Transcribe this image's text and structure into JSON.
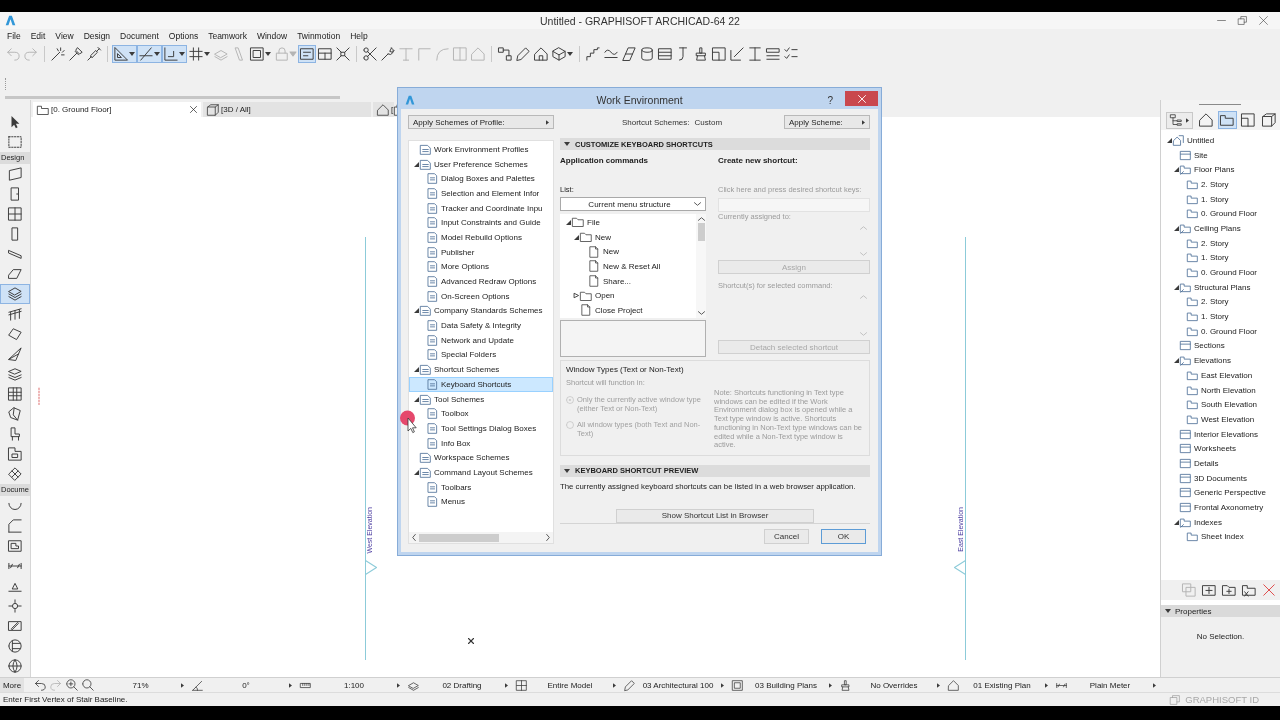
{
  "window": {
    "title": "Untitled - GRAPHISOFT ARCHICAD-64 22"
  },
  "menu_bar": [
    "File",
    "Edit",
    "View",
    "Design",
    "Document",
    "Options",
    "Teamwork",
    "Window",
    "Twinmotion",
    "Help"
  ],
  "toolbar": [
    [
      {
        "selected": false,
        "disabled": true
      },
      {
        "selected": false,
        "disabled": true
      }
    ],
    [
      {
        "selected": false,
        "disabled": false
      },
      {
        "selected": false,
        "disabled": false
      },
      {
        "selected": false,
        "disabled": false
      }
    ],
    [
      {
        "selected": true,
        "disabled": false,
        "dropdown": true
      },
      {
        "selected": true,
        "disabled": false,
        "dropdown": true
      },
      {
        "selected": true,
        "disabled": false,
        "dropdown": true
      },
      {
        "selected": false,
        "disabled": false,
        "dropdown": true
      },
      {
        "selected": false,
        "disabled": true
      },
      {
        "selected": false,
        "disabled": true
      },
      {
        "selected": false,
        "disabled": false,
        "dropdown": true
      },
      {
        "selected": false,
        "disabled": true,
        "dropdown": true
      },
      {
        "selected": true,
        "disabled": false
      },
      {
        "selected": false,
        "disabled": false
      },
      {
        "selected": false,
        "disabled": false
      }
    ],
    [
      {
        "selected": false,
        "disabled": false
      },
      {
        "selected": false,
        "disabled": false
      },
      {
        "selected": false,
        "disabled": true
      },
      {
        "selected": false,
        "disabled": true
      },
      {
        "selected": false,
        "disabled": true
      },
      {
        "selected": false,
        "disabled": true
      },
      {
        "selected": false,
        "disabled": true
      }
    ],
    [
      {
        "selected": false,
        "disabled": false
      },
      {
        "selected": false,
        "disabled": false
      },
      {
        "selected": false,
        "disabled": false
      },
      {
        "selected": false,
        "disabled": false,
        "dropdown": true
      }
    ],
    [
      {
        "selected": false,
        "disabled": false
      },
      {
        "selected": false,
        "disabled": false
      },
      {
        "selected": false,
        "disabled": false
      },
      {
        "selected": false,
        "disabled": false
      },
      {
        "selected": false,
        "disabled": false
      },
      {
        "selected": false,
        "disabled": false
      },
      {
        "selected": false,
        "disabled": false
      },
      {
        "selected": false,
        "disabled": false
      },
      {
        "selected": false,
        "disabled": false
      },
      {
        "selected": false,
        "disabled": false
      },
      {
        "selected": false,
        "disabled": false
      },
      {
        "selected": false,
        "disabled": false
      }
    ]
  ],
  "toolbox": {
    "pointer_tools": [
      {
        "selected": false
      },
      {
        "selected": false
      }
    ],
    "sections": [
      {
        "label": "Design",
        "tools": [
          {
            "selected": false
          },
          {
            "selected": false
          },
          {
            "selected": false
          },
          {
            "selected": false
          },
          {
            "selected": false
          },
          {
            "selected": false
          },
          {
            "selected": true
          },
          {
            "selected": false
          },
          {
            "selected": false
          },
          {
            "selected": false
          },
          {
            "selected": false
          },
          {
            "selected": false
          },
          {
            "selected": false
          },
          {
            "selected": false
          },
          {
            "selected": false
          },
          {
            "selected": false
          }
        ]
      },
      {
        "label": "Docume",
        "tools": [
          {
            "selected": false
          },
          {
            "selected": false
          },
          {
            "selected": false
          },
          {
            "selected": false
          },
          {
            "selected": false
          },
          {
            "selected": false
          },
          {
            "selected": false
          },
          {
            "selected": false
          },
          {
            "selected": false
          }
        ]
      }
    ]
  },
  "tabs": [
    {
      "label": "[0. Ground Floor]",
      "selected": true,
      "closable": true
    },
    {
      "label": "[3D / All]",
      "selected": false,
      "closable": false
    },
    {
      "label": "[",
      "selected": false,
      "closable": false
    }
  ],
  "canvas": {
    "elevation_markers": [
      {
        "label": "West Elevation"
      },
      {
        "label": "East Elevation"
      }
    ]
  },
  "navigator": {
    "views": [
      {
        "selected": false
      },
      {
        "selected": true
      },
      {
        "selected": false
      },
      {
        "selected": false
      }
    ],
    "tree": [
      {
        "label": "Untitled",
        "expanded": true,
        "selected": false,
        "children": [
          {
            "label": "Site",
            "expanded": false,
            "selected": false
          },
          {
            "label": "Floor Plans",
            "expanded": true,
            "selected": false,
            "children": [
              {
                "label": "2. Story",
                "expanded": false,
                "selected": false
              },
              {
                "label": "1. Story",
                "expanded": false,
                "selected": false
              },
              {
                "label": "0. Ground Floor",
                "expanded": false,
                "selected": false
              }
            ]
          },
          {
            "label": "Ceiling Plans",
            "expanded": true,
            "selected": false,
            "children": [
              {
                "label": "2. Story",
                "expanded": false,
                "selected": false
              },
              {
                "label": "1. Story",
                "expanded": false,
                "selected": false
              },
              {
                "label": "0. Ground Floor",
                "expanded": false,
                "selected": false
              }
            ]
          },
          {
            "label": "Structural Plans",
            "expanded": true,
            "selected": false,
            "children": [
              {
                "label": "2. Story",
                "expanded": false,
                "selected": false
              },
              {
                "label": "1. Story",
                "expanded": false,
                "selected": false
              },
              {
                "label": "0. Ground Floor",
                "expanded": false,
                "selected": false
              }
            ]
          },
          {
            "label": "Sections",
            "expanded": false,
            "selected": false
          },
          {
            "label": "Elevations",
            "expanded": true,
            "selected": false,
            "children": [
              {
                "label": "East Elevation",
                "expanded": false,
                "selected": false
              },
              {
                "label": "North Elevation",
                "expanded": false,
                "selected": false
              },
              {
                "label": "South Elevation",
                "expanded": false,
                "selected": false
              },
              {
                "label": "West Elevation",
                "expanded": false,
                "selected": false
              }
            ]
          },
          {
            "label": "Interior Elevations",
            "expanded": false,
            "selected": false
          },
          {
            "label": "Worksheets",
            "expanded": false,
            "selected": false
          },
          {
            "label": "Details",
            "expanded": false,
            "selected": false
          },
          {
            "label": "3D Documents",
            "expanded": false,
            "selected": false
          },
          {
            "label": "Generic Perspective",
            "expanded": false,
            "selected": false
          },
          {
            "label": "Frontal Axonometry",
            "expanded": false,
            "selected": false
          },
          {
            "label": "Indexes",
            "expanded": true,
            "selected": false,
            "children": [
              {
                "label": "Sheet Index",
                "expanded": false,
                "selected": false
              }
            ]
          }
        ]
      }
    ],
    "actions": [
      {
        "disabled": true
      },
      {
        "disabled": false
      },
      {
        "disabled": false
      },
      {
        "disabled": false
      },
      {
        "disabled": false
      }
    ]
  },
  "properties": {
    "title": "Properties",
    "expanded": true,
    "content": "No Selection."
  },
  "view_bar": {
    "more": "More",
    "nav_buttons": [
      {
        "disabled": false
      },
      {
        "disabled": true
      },
      {
        "disabled": false
      },
      {
        "disabled": false
      }
    ],
    "fields": [
      "71%",
      "0°",
      "1:100",
      "02 Drafting",
      "Entire Model",
      "03 Architectural 100",
      "03 Building Plans",
      "No Overrides",
      "01 Existing Plan",
      "Plain Meter"
    ]
  },
  "status_bar": {
    "prompt": "Enter First Vertex of Stair Baseline.",
    "brand": "GRAPHISOFT ID"
  },
  "dialog": {
    "title": "Work Environment",
    "help": "?",
    "profile_button": "Apply Schemes of Profile:",
    "scheme_tree": [
      {
        "label": "Work Environment Profiles",
        "expanded": false,
        "selected": false
      },
      {
        "label": "User Preference Schemes",
        "expanded": true,
        "selected": false,
        "children": [
          {
            "label": "Dialog Boxes and Palettes",
            "expanded": false,
            "selected": false
          },
          {
            "label": "Selection and Element Infor",
            "expanded": false,
            "selected": false
          },
          {
            "label": "Tracker and Coordinate Inpu",
            "expanded": false,
            "selected": false
          },
          {
            "label": "Input Constraints and Guide",
            "expanded": false,
            "selected": false
          },
          {
            "label": "Model Rebuild Options",
            "expanded": false,
            "selected": false
          },
          {
            "label": "Publisher",
            "expanded": false,
            "selected": false
          },
          {
            "label": "More Options",
            "expanded": false,
            "selected": false
          },
          {
            "label": "Advanced Redraw Options",
            "expanded": false,
            "selected": false
          },
          {
            "label": "On-Screen Options",
            "expanded": false,
            "selected": false
          }
        ]
      },
      {
        "label": "Company Standards Schemes",
        "expanded": true,
        "selected": false,
        "children": [
          {
            "label": "Data Safety & Integrity",
            "expanded": false,
            "selected": false
          },
          {
            "label": "Network and Update",
            "expanded": false,
            "selected": false
          },
          {
            "label": "Special Folders",
            "expanded": false,
            "selected": false
          }
        ]
      },
      {
        "label": "Shortcut Schemes",
        "expanded": true,
        "selected": false,
        "children": [
          {
            "label": "Keyboard Shortcuts",
            "expanded": false,
            "selected": true
          }
        ]
      },
      {
        "label": "Tool Schemes",
        "expanded": true,
        "selected": false,
        "children": [
          {
            "label": "Toolbox",
            "expanded": false,
            "selected": false
          },
          {
            "label": "Tool Settings Dialog Boxes",
            "expanded": false,
            "selected": false
          },
          {
            "label": "Info Box",
            "expanded": false,
            "selected": false
          }
        ]
      },
      {
        "label": "Workspace Schemes",
        "expanded": false,
        "selected": false
      },
      {
        "label": "Command Layout Schemes",
        "expanded": true,
        "selected": false,
        "children": [
          {
            "label": "Toolbars",
            "expanded": false,
            "selected": false
          },
          {
            "label": "Menus",
            "expanded": false,
            "selected": false
          }
        ]
      }
    ],
    "scheme_label": "Shortcut Schemes:",
    "scheme_value": "Custom",
    "apply_button": "Apply Scheme:",
    "customize": {
      "title": "CUSTOMIZE KEYBOARD SHORTCUTS",
      "expanded": true,
      "commands_heading": "Application commands",
      "list_label": "List:",
      "list_value": "Current menu structure",
      "command_tree": [
        {
          "label": "File",
          "expanded": true,
          "selected": false,
          "children": [
            {
              "label": "New",
              "expanded": true,
              "selected": false,
              "children": [
                {
                  "label": "New",
                  "expanded": false,
                  "selected": false
                },
                {
                  "label": "New & Reset All",
                  "expanded": false,
                  "selected": false
                },
                {
                  "label": "Share...",
                  "expanded": false,
                  "selected": false
                }
              ]
            },
            {
              "label": "Open",
              "expanded": false,
              "selected": false,
              "has_children": true
            },
            {
              "label": "Close Project",
              "expanded": false,
              "selected": false
            }
          ]
        }
      ],
      "shortcut_heading": "Create new shortcut:",
      "key_hint": "Click here and press desired shortcut keys:",
      "assigned_label": "Currently assigned to:",
      "assign_button": {
        "label": "Assign",
        "disabled": true
      },
      "shortcuts_label": "Shortcut(s) for selected command:",
      "detach_button": {
        "label": "Detach selected shortcut",
        "disabled": true
      },
      "window_types": {
        "title": "Window Types (Text or Non-Text)",
        "hint": "Shortcut will function in:",
        "options": [
          {
            "label": "Only the currently active window type (either Text or Non-Text)",
            "checked": true,
            "disabled": true
          },
          {
            "label": "All window types (both Text and Non-Text)",
            "checked": false,
            "disabled": true
          }
        ],
        "note": "Note: Shortcuts functioning in Text type windows can be edited if the Work Environment dialog box is opened while a Text type window is active. Shortcuts functioning in Non-Text type windows can be edited while a Non-Text type window is active."
      }
    },
    "preview": {
      "title": "KEYBOARD SHORTCUT PREVIEW",
      "expanded": true,
      "text": "The currently assigned keyboard shortcuts can be listed in a web browser application.",
      "button": "Show Shortcut List in Browser"
    },
    "buttons": [
      "Cancel",
      "OK"
    ]
  }
}
